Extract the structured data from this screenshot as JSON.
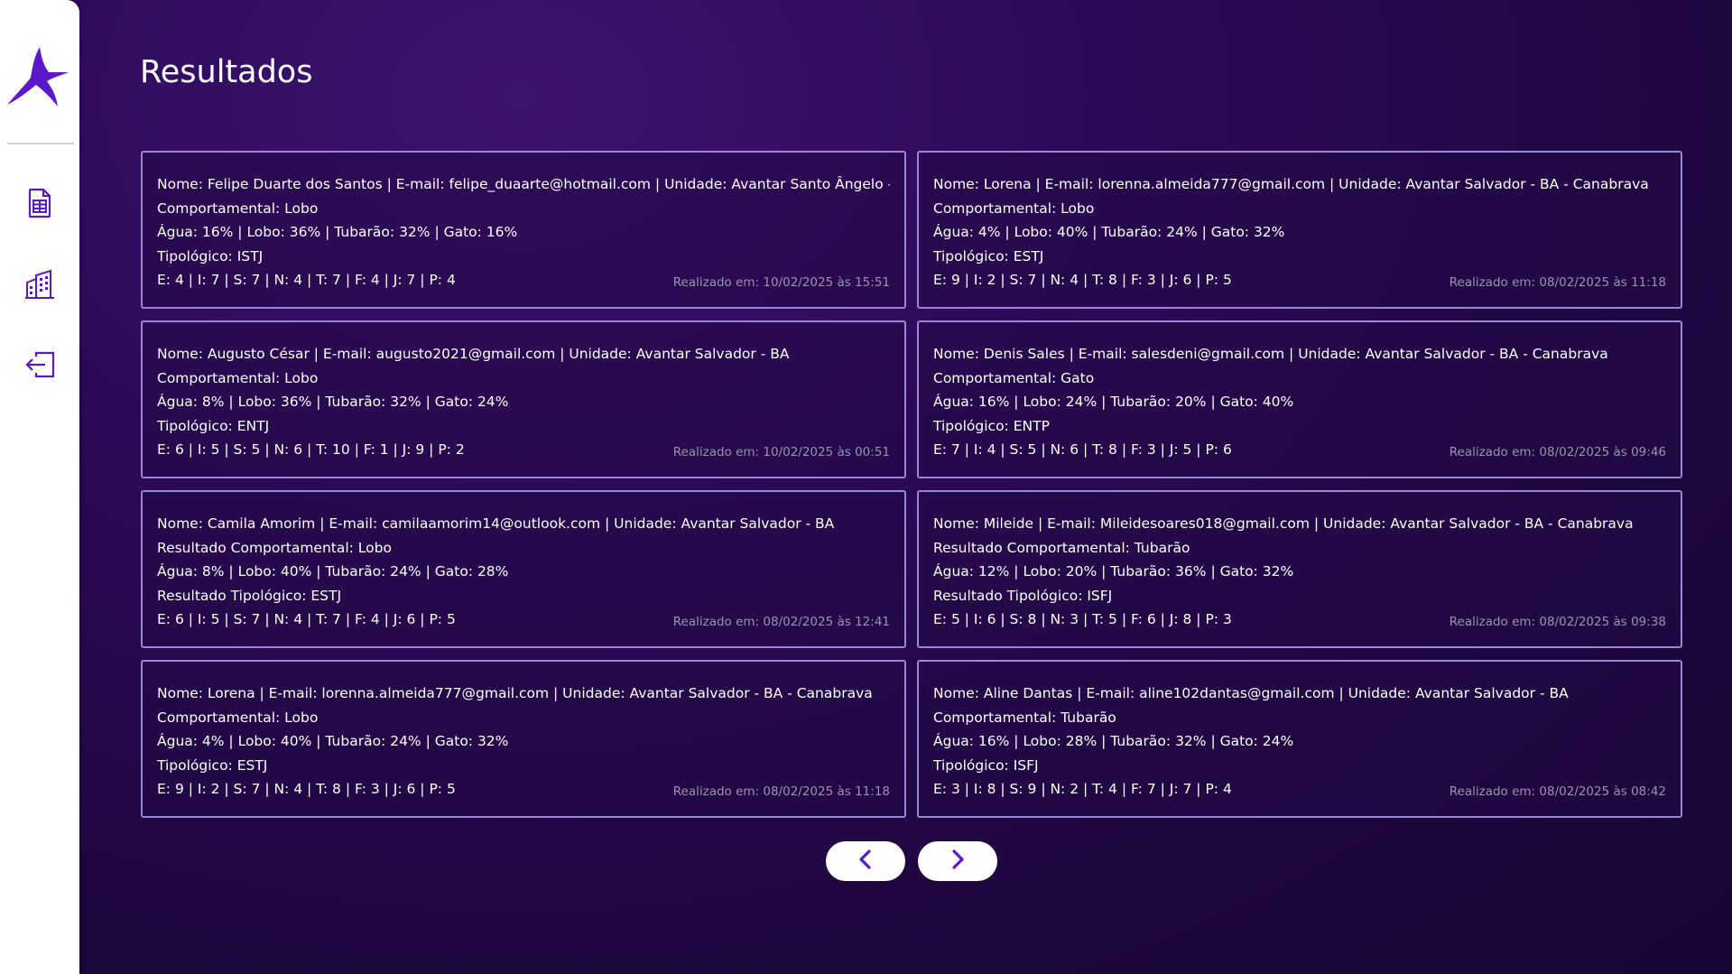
{
  "sidebar": {
    "logo": "avantar-logo",
    "items": [
      {
        "icon": "spreadsheet-icon"
      },
      {
        "icon": "building-icon"
      },
      {
        "icon": "logout-icon"
      }
    ]
  },
  "page": {
    "title": "Resultados"
  },
  "results": [
    {
      "l1": "Nome: Felipe Duarte dos Santos | E-mail: felipe_duaarte@hotmail.com | Unidade: Avantar Santo Ângelo - RS",
      "l2": "Comportamental: Lobo",
      "l3": "Água: 16% | Lobo: 36% | Tubarão: 32% | Gato: 16%",
      "l4": "Tipológico: ISTJ",
      "l5": "E: 4 | I: 7 | S: 7 | N: 4 | T: 7 | F: 4 | J: 7 | P: 4",
      "date": "Realizado em: 10/02/2025 às 15:51"
    },
    {
      "l1": "Nome: Lorena | E-mail: lorenna.almeida777@gmail.com | Unidade: Avantar Salvador - BA - Canabrava",
      "l2": "Comportamental: Lobo",
      "l3": "Água: 4% | Lobo: 40% | Tubarão: 24% | Gato: 32%",
      "l4": "Tipológico: ESTJ",
      "l5": "E: 9 | I: 2 | S: 7 | N: 4 | T: 8 | F: 3 | J: 6 | P: 5",
      "date": "Realizado em: 08/02/2025 às 11:18"
    },
    {
      "l1": "Nome: Augusto César | E-mail: augusto2021@gmail.com | Unidade: Avantar Salvador - BA",
      "l2": "Comportamental: Lobo",
      "l3": "Água: 8% | Lobo: 36% | Tubarão: 32% | Gato: 24%",
      "l4": "Tipológico: ENTJ",
      "l5": "E: 6 | I: 5 | S: 5 | N: 6 | T: 10 | F: 1 | J: 9 | P: 2",
      "date": "Realizado em: 10/02/2025 às 00:51"
    },
    {
      "l1": "Nome: Denis Sales | E-mail: salesdeni@gmail.com | Unidade: Avantar Salvador - BA - Canabrava",
      "l2": "Comportamental: Gato",
      "l3": "Água: 16% | Lobo: 24% | Tubarão: 20% | Gato: 40%",
      "l4": "Tipológico: ENTP",
      "l5": "E: 7 | I: 4 | S: 5 | N: 6 | T: 8 | F: 3 | J: 5 | P: 6",
      "date": "Realizado em: 08/02/2025 às 09:46"
    },
    {
      "l1": "Nome: Camila Amorim | E-mail: camilaamorim14@outlook.com | Unidade: Avantar Salvador - BA",
      "l2": "Resultado Comportamental: Lobo",
      "l3": "Água: 8% | Lobo: 40% | Tubarão: 24% | Gato: 28%",
      "l4": "Resultado Tipológico: ESTJ",
      "l5": "E: 6 | I: 5 | S: 7 | N: 4 | T: 7 | F: 4 | J: 6 | P: 5",
      "date": "Realizado em: 08/02/2025 às 12:41"
    },
    {
      "l1": "Nome: Mileide | E-mail: Mileidesoares018@gmail.com | Unidade: Avantar Salvador - BA - Canabrava",
      "l2": "Resultado Comportamental: Tubarão",
      "l3": "Água: 12% | Lobo: 20% | Tubarão: 36% | Gato: 32%",
      "l4": "Resultado Tipológico: ISFJ",
      "l5": "E: 5 | I: 6 | S: 8 | N: 3 | T: 5 | F: 6 | J: 8 | P: 3",
      "date": "Realizado em: 08/02/2025 às 09:38"
    },
    {
      "l1": "Nome: Lorena | E-mail: lorenna.almeida777@gmail.com | Unidade: Avantar Salvador - BA - Canabrava",
      "l2": "Comportamental: Lobo",
      "l3": "Água: 4% | Lobo: 40% | Tubarão: 24% | Gato: 32%",
      "l4": "Tipológico: ESTJ",
      "l5": "E: 9 | I: 2 | S: 7 | N: 4 | T: 8 | F: 3 | J: 6 | P: 5",
      "date": "Realizado em: 08/02/2025 às 11:18"
    },
    {
      "l1": "Nome: Aline Dantas | E-mail: aline102dantas@gmail.com | Unidade: Avantar Salvador - BA",
      "l2": "Comportamental: Tubarão",
      "l3": "Água: 16% | Lobo: 28% | Tubarão: 32% | Gato: 24%",
      "l4": "Tipológico: ISFJ",
      "l5": "E: 3 | I: 8 | S: 9 | N: 2 | T: 4 | F: 7 | J: 7 | P: 4",
      "date": "Realizado em: 08/02/2025 às 08:42"
    }
  ],
  "pagination": {
    "prev_icon": "chevron-left-icon",
    "next_icon": "chevron-right-icon"
  },
  "colors": {
    "accent": "#5b17c9",
    "card_border": "#9a86d8",
    "date_text": "#9b93ad"
  }
}
